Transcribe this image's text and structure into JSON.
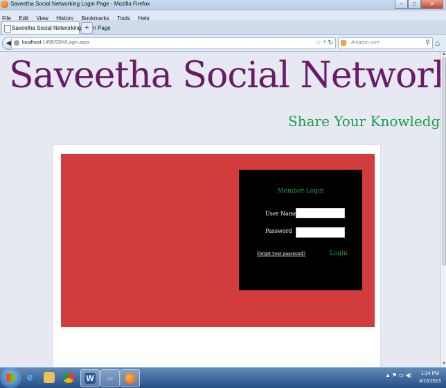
{
  "window": {
    "title": "Saveetha Social Networking Login Page - Mozilla Firefox"
  },
  "menu": [
    "File",
    "Edit",
    "View",
    "History",
    "Bookmarks",
    "Tools",
    "Help"
  ],
  "tab": {
    "label": "Saveetha Social Networking Login Page",
    "new_tab": "+"
  },
  "nav": {
    "url_host": "localhost",
    "url_rest": ":1456/SSN/Login.aspx",
    "search_placeholder": "Amazon.com"
  },
  "page": {
    "brand": "Saveetha Social Networking",
    "tagline": "Share Your Knowledge",
    "login": {
      "title": "Member Login",
      "username_label": "User Name",
      "password_label": "Password",
      "username_value": "",
      "password_value": "",
      "forgot_link": "Forgot your password?",
      "login_button": "Login"
    }
  },
  "taskbar": {
    "apps": [
      "ie-icon",
      "explorer-folder-icon",
      "chrome-icon",
      "word-icon",
      "visual-studio-icon",
      "firefox-icon"
    ],
    "clock_time": "1:14 PM",
    "clock_date": "4/16/2013"
  },
  "colors": {
    "brand": "#6b1a67",
    "accent_green": "#1a9b4a",
    "banner_red": "#d33c3c",
    "login_bg": "#000000"
  }
}
